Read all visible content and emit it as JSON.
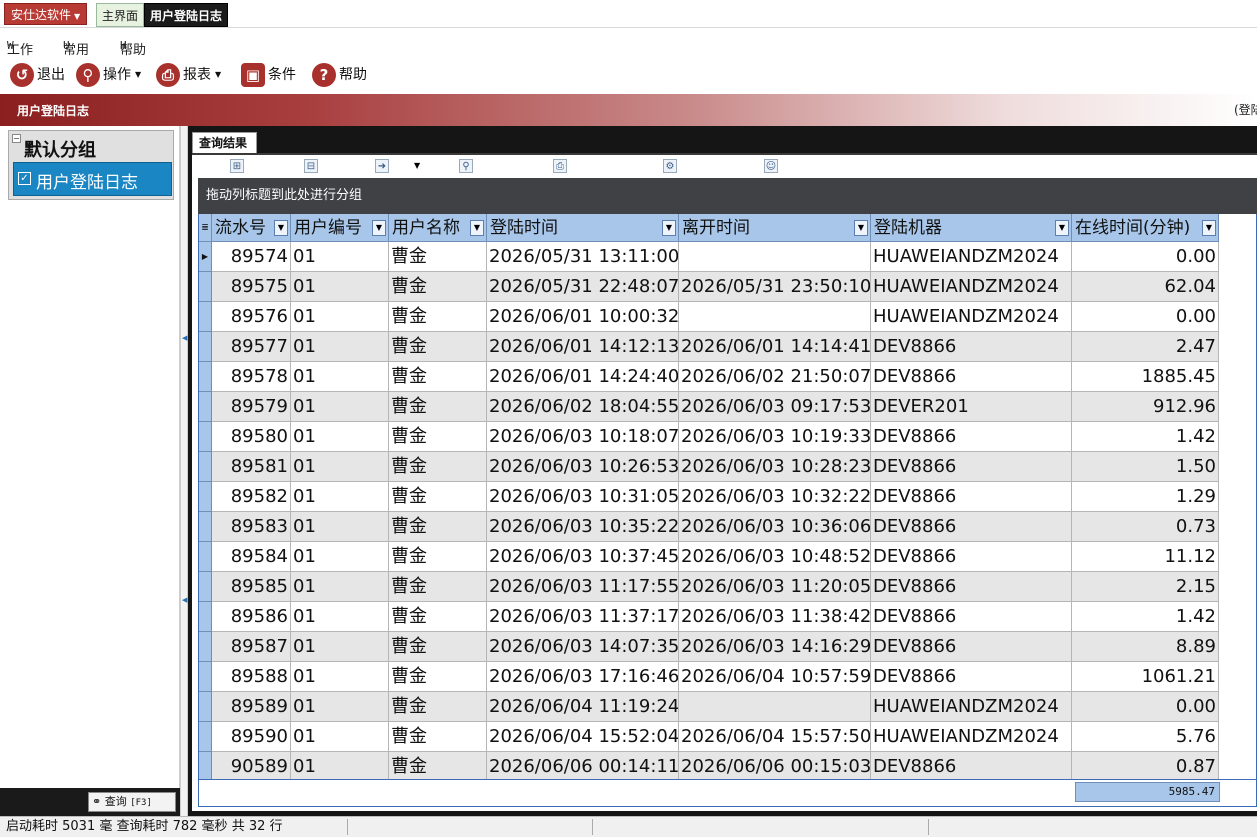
{
  "app_menu": {
    "label": "安仕达软件"
  },
  "top_tabs": [
    {
      "label": "主界面"
    },
    {
      "label": "用户登陆日志"
    }
  ],
  "menubar": [
    {
      "key": "W",
      "label": "工作"
    },
    {
      "key": "U",
      "label": "常用"
    },
    {
      "key": "H",
      "label": "帮助"
    }
  ],
  "toolbar": [
    {
      "label": "退出",
      "icon": "exit-icon"
    },
    {
      "label": "操作",
      "icon": "search-icon"
    },
    {
      "label": "报表",
      "icon": "printer-icon"
    },
    {
      "label": "条件",
      "icon": "condition-icon"
    },
    {
      "label": "帮助",
      "icon": "help-icon"
    }
  ],
  "banner": {
    "title": "用户登陆日志",
    "right_text": "(登陆"
  },
  "left_panel": {
    "group_title": "默认分组",
    "item_label": "用户登陆日志",
    "query_button": "查询",
    "query_hotkey": "[F3]"
  },
  "result_tab": {
    "label": "查询结果"
  },
  "group_by_hint": "拖动列标题到此处进行分组",
  "grid": {
    "columns": [
      "流水号",
      "用户编号",
      "用户名称",
      "登陆时间",
      "离开时间",
      "登陆机器",
      "在线时间(分钟)"
    ],
    "rows": [
      [
        "89574",
        "01",
        "曹金",
        "2026/05/31 13:11:00",
        "",
        "HUAWEIANDZM2024",
        "0.00"
      ],
      [
        "89575",
        "01",
        "曹金",
        "2026/05/31 22:48:07",
        "2026/05/31 23:50:10",
        "HUAWEIANDZM2024",
        "62.04"
      ],
      [
        "89576",
        "01",
        "曹金",
        "2026/06/01 10:00:32",
        "",
        "HUAWEIANDZM2024",
        "0.00"
      ],
      [
        "89577",
        "01",
        "曹金",
        "2026/06/01 14:12:13",
        "2026/06/01 14:14:41",
        "DEV8866",
        "2.47"
      ],
      [
        "89578",
        "01",
        "曹金",
        "2026/06/01 14:24:40",
        "2026/06/02 21:50:07",
        "DEV8866",
        "1885.45"
      ],
      [
        "89579",
        "01",
        "曹金",
        "2026/06/02 18:04:55",
        "2026/06/03 09:17:53",
        "DEVER201",
        "912.96"
      ],
      [
        "89580",
        "01",
        "曹金",
        "2026/06/03 10:18:07",
        "2026/06/03 10:19:33",
        "DEV8866",
        "1.42"
      ],
      [
        "89581",
        "01",
        "曹金",
        "2026/06/03 10:26:53",
        "2026/06/03 10:28:23",
        "DEV8866",
        "1.50"
      ],
      [
        "89582",
        "01",
        "曹金",
        "2026/06/03 10:31:05",
        "2026/06/03 10:32:22",
        "DEV8866",
        "1.29"
      ],
      [
        "89583",
        "01",
        "曹金",
        "2026/06/03 10:35:22",
        "2026/06/03 10:36:06",
        "DEV8866",
        "0.73"
      ],
      [
        "89584",
        "01",
        "曹金",
        "2026/06/03 10:37:45",
        "2026/06/03 10:48:52",
        "DEV8866",
        "11.12"
      ],
      [
        "89585",
        "01",
        "曹金",
        "2026/06/03 11:17:55",
        "2026/06/03 11:20:05",
        "DEV8866",
        "2.15"
      ],
      [
        "89586",
        "01",
        "曹金",
        "2026/06/03 11:37:17",
        "2026/06/03 11:38:42",
        "DEV8866",
        "1.42"
      ],
      [
        "89587",
        "01",
        "曹金",
        "2026/06/03 14:07:35",
        "2026/06/03 14:16:29",
        "DEV8866",
        "8.89"
      ],
      [
        "89588",
        "01",
        "曹金",
        "2026/06/03 17:16:46",
        "2026/06/04 10:57:59",
        "DEV8866",
        "1061.21"
      ],
      [
        "89589",
        "01",
        "曹金",
        "2026/06/04 11:19:24",
        "",
        "HUAWEIANDZM2024",
        "0.00"
      ],
      [
        "89590",
        "01",
        "曹金",
        "2026/06/04 15:52:04",
        "2026/06/04 15:57:50",
        "HUAWEIANDZM2024",
        "5.76"
      ],
      [
        "90589",
        "01",
        "曹金",
        "2026/06/06 00:14:11",
        "2026/06/06 00:15:03",
        "DEV8866",
        "0.87"
      ]
    ],
    "summary_total": "5985.47"
  },
  "status": {
    "text": "启动耗时 5031 毫 查询耗时 782 毫秒  共 32 行"
  },
  "colors": {
    "app_menu_bg": "#b83a34",
    "header_bg": "#a7c6e9",
    "selected_group_item": "#1b86c4",
    "banner_start": "#8b1f1f"
  }
}
